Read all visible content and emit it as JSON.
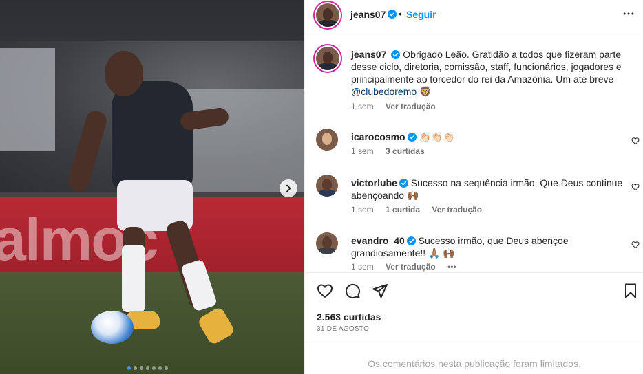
{
  "post": {
    "author": "jeans07",
    "follow_label": "Seguir",
    "separator": "•",
    "media": {
      "slide_count": 7,
      "active_slide": 0,
      "board_text": "almoc"
    }
  },
  "caption": {
    "username": "jeans07",
    "text": "Obrigado Leão. Gratidão a todos que fizeram parte desse ciclo, diretoria, comissão, staff, funcionários, jogadores e principalmente ao torcedor do rei da Amazônia. Um até breve",
    "mention": "@clubedoremo",
    "emoji": "🦁",
    "time": "1 sem",
    "translate": "Ver tradução"
  },
  "comments": [
    {
      "username": "icarocosmo",
      "text": "👏🏻👏🏻👏🏻",
      "time": "1 sem",
      "likes": "3 curtidas",
      "translate": ""
    },
    {
      "username": "victorlube",
      "text": "Sucesso na sequência irmão. Que Deus continue abençoando 🙌🏾",
      "time": "1 sem",
      "likes": "1 curtida",
      "translate": "Ver tradução"
    },
    {
      "username": "evandro_40",
      "text": "Sucesso irmão, que Deus abençoe grandiosamente!! 🙏🏽 🙌🏾",
      "time": "1 sem",
      "likes": "",
      "translate": "Ver tradução",
      "more": "•••"
    }
  ],
  "actions": {
    "icons": [
      "heart-icon",
      "comment-icon",
      "share-icon",
      "bookmark-icon"
    ]
  },
  "likes_label": "2.563 curtidas",
  "date_label": "31 DE AGOSTO",
  "limited_label": "Os comentários nesta publicação foram limitados.",
  "colors": {
    "link": "#0095f6",
    "verified": "#0095f6",
    "muted": "#737373"
  }
}
